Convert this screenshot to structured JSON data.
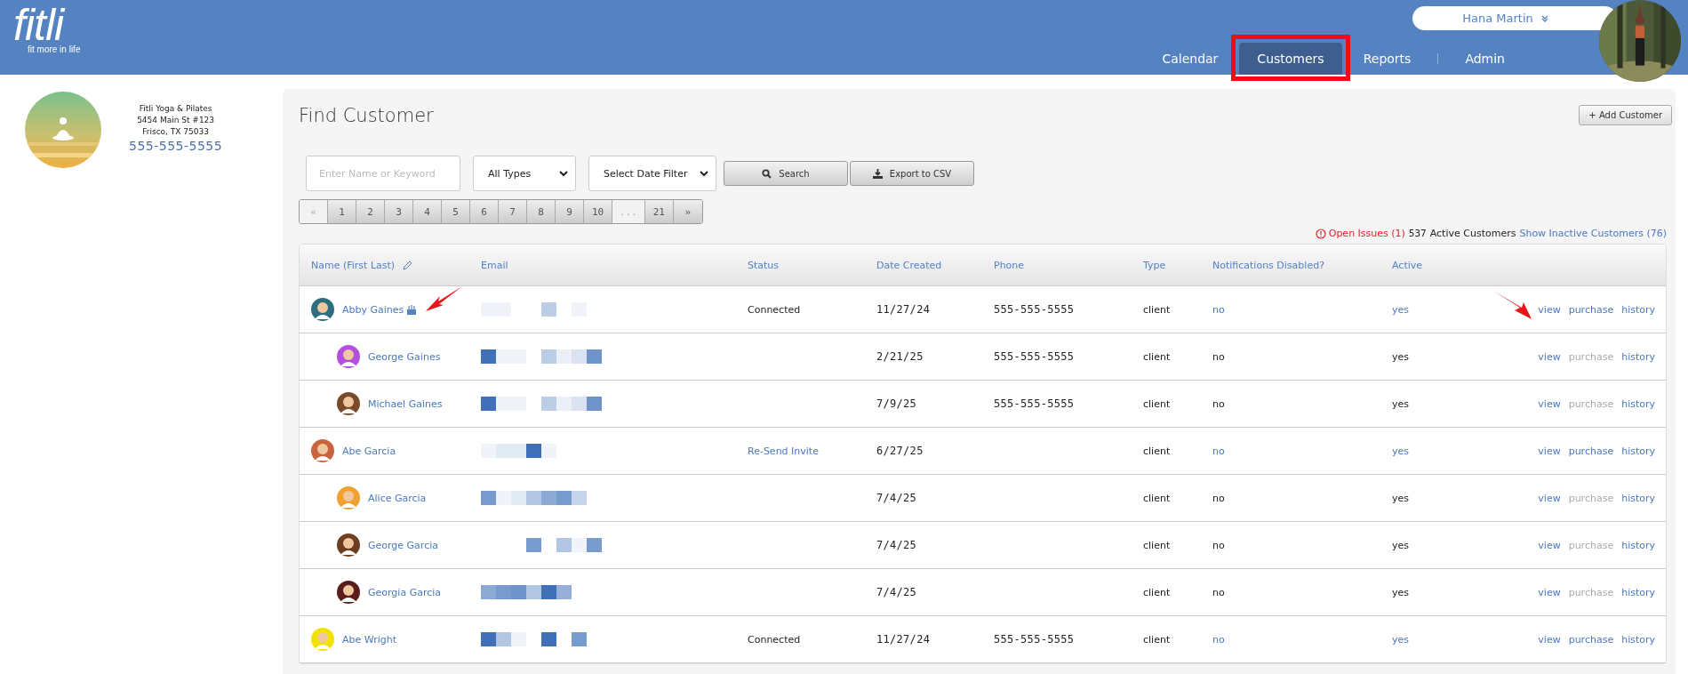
{
  "header": {
    "logo": "fitli",
    "tagline": "fit more in life",
    "user": "Hana Martin",
    "nav": [
      {
        "label": "Calendar",
        "selected": false,
        "highlighted": false
      },
      {
        "label": "Customers",
        "selected": true,
        "highlighted": true
      },
      {
        "label": "Reports",
        "selected": false,
        "highlighted": false
      },
      {
        "label": "Admin",
        "selected": false,
        "highlighted": false
      }
    ]
  },
  "studio": {
    "name": "Fitli Yoga & Pilates",
    "address": "5454 Main St #123",
    "city": "Frisco, TX 75033",
    "phone": "555-555-5555"
  },
  "page": {
    "title": "Find Customer",
    "add_button": "+ Add Customer"
  },
  "filters": {
    "search": {
      "placeholder": "Enter Name or Keyword"
    },
    "type_select": "All Types",
    "date_select": "Select Date Filter",
    "search_button": "Search",
    "export_button": "Export to CSV"
  },
  "pagination": [
    {
      "label": "«",
      "disabled": true
    },
    {
      "label": "1",
      "disabled": false
    },
    {
      "label": "2",
      "disabled": false
    },
    {
      "label": "3",
      "disabled": false
    },
    {
      "label": "4",
      "disabled": false
    },
    {
      "label": "5",
      "disabled": false
    },
    {
      "label": "6",
      "disabled": false
    },
    {
      "label": "7",
      "disabled": false
    },
    {
      "label": "8",
      "disabled": false
    },
    {
      "label": "9",
      "disabled": false
    },
    {
      "label": "10",
      "disabled": false
    },
    {
      "label": "...",
      "disabled": true
    },
    {
      "label": "21",
      "disabled": false
    },
    {
      "label": "»",
      "disabled": false
    }
  ],
  "summary": {
    "open_issues": "Open Issues (1)",
    "active_count": "537",
    "active_label": "Active Customers",
    "inactive_link": "Show Inactive Customers (76)"
  },
  "table": {
    "columns": [
      "Name (First Last)",
      "Email",
      "Status",
      "Date Created",
      "Phone",
      "Type",
      "Notifications Disabled?",
      "Active"
    ],
    "rows": [
      {
        "name": "Abby Gaines",
        "birthday": true,
        "marked": true,
        "status": {
          "text": "Connected",
          "kind": "text"
        },
        "date": "11/27/24",
        "phone": "555-555-5555",
        "type": "client",
        "notifications": "no",
        "active": "yes",
        "actions": [
          {
            "label": "view",
            "disabled": false
          },
          {
            "label": "purchase",
            "disabled": false
          },
          {
            "label": "history",
            "disabled": false
          }
        ],
        "children": [
          {
            "name": "George Gaines",
            "birthday": false,
            "marked": false,
            "date": "2/21/25",
            "phone": "555-555-5555",
            "type": "client",
            "notifications": "no",
            "active": "yes",
            "actions": [
              {
                "label": "view",
                "disabled": false
              },
              {
                "label": "purchase",
                "disabled": true
              },
              {
                "label": "history",
                "disabled": false
              }
            ]
          },
          {
            "name": "Michael Gaines",
            "birthday": false,
            "marked": false,
            "date": "7/9/25",
            "phone": "555-555-5555",
            "type": "client",
            "notifications": "no",
            "active": "yes",
            "actions": [
              {
                "label": "view",
                "disabled": false
              },
              {
                "label": "purchase",
                "disabled": true
              },
              {
                "label": "history",
                "disabled": false
              }
            ]
          }
        ]
      },
      {
        "name": "Abe Garcia",
        "birthday": false,
        "marked": false,
        "status": {
          "text": "Re-Send Invite",
          "kind": "link"
        },
        "date": "6/27/25",
        "type": "client",
        "notifications": "no",
        "active": "yes",
        "actions": [
          {
            "label": "view",
            "disabled": false
          },
          {
            "label": "purchase",
            "disabled": false
          },
          {
            "label": "history",
            "disabled": false
          }
        ],
        "children": [
          {
            "name": "Alice Garcia",
            "birthday": false,
            "marked": false,
            "date": "7/4/25",
            "type": "client",
            "notifications": "no",
            "active": "yes",
            "actions": [
              {
                "label": "view",
                "disabled": false
              },
              {
                "label": "purchase",
                "disabled": true
              },
              {
                "label": "history",
                "disabled": false
              }
            ]
          },
          {
            "name": "George Garcia",
            "birthday": false,
            "marked": false,
            "date": "7/4/25",
            "type": "client",
            "notifications": "no",
            "active": "yes",
            "actions": [
              {
                "label": "view",
                "disabled": false
              },
              {
                "label": "purchase",
                "disabled": true
              },
              {
                "label": "history",
                "disabled": false
              }
            ]
          },
          {
            "name": "Georgia Garcia",
            "birthday": false,
            "marked": false,
            "date": "7/4/25",
            "type": "client",
            "notifications": "no",
            "active": "yes",
            "actions": [
              {
                "label": "view",
                "disabled": false
              },
              {
                "label": "purchase",
                "disabled": true
              },
              {
                "label": "history",
                "disabled": false
              }
            ]
          }
        ]
      },
      {
        "name": "Abe Wright",
        "birthday": false,
        "marked": false,
        "status": {
          "text": "Connected",
          "kind": "text"
        },
        "date": "11/27/24",
        "phone": "555-555-5555",
        "type": "client",
        "notifications": "no",
        "active": "yes",
        "actions": [
          {
            "label": "view",
            "disabled": false
          },
          {
            "label": "purchase",
            "disabled": false
          },
          {
            "label": "history",
            "disabled": false
          }
        ]
      }
    ]
  }
}
